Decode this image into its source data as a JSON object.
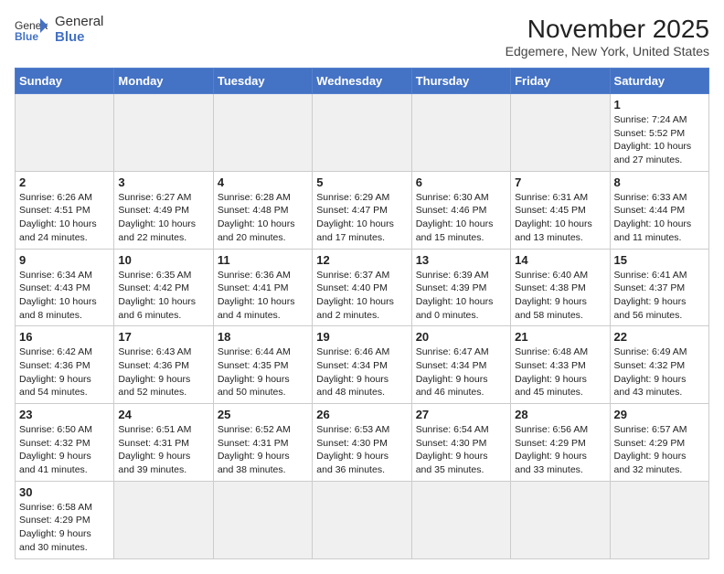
{
  "header": {
    "logo_general": "General",
    "logo_blue": "Blue",
    "title": "November 2025",
    "subtitle": "Edgemere, New York, United States"
  },
  "weekdays": [
    "Sunday",
    "Monday",
    "Tuesday",
    "Wednesday",
    "Thursday",
    "Friday",
    "Saturday"
  ],
  "weeks": [
    [
      {
        "day": "",
        "empty": true
      },
      {
        "day": "",
        "empty": true
      },
      {
        "day": "",
        "empty": true
      },
      {
        "day": "",
        "empty": true
      },
      {
        "day": "",
        "empty": true
      },
      {
        "day": "",
        "empty": true
      },
      {
        "day": "1",
        "info": "Sunrise: 7:24 AM\nSunset: 5:52 PM\nDaylight: 10 hours\nand 27 minutes."
      }
    ],
    [
      {
        "day": "2",
        "info": "Sunrise: 6:26 AM\nSunset: 4:51 PM\nDaylight: 10 hours\nand 24 minutes."
      },
      {
        "day": "3",
        "info": "Sunrise: 6:27 AM\nSunset: 4:49 PM\nDaylight: 10 hours\nand 22 minutes."
      },
      {
        "day": "4",
        "info": "Sunrise: 6:28 AM\nSunset: 4:48 PM\nDaylight: 10 hours\nand 20 minutes."
      },
      {
        "day": "5",
        "info": "Sunrise: 6:29 AM\nSunset: 4:47 PM\nDaylight: 10 hours\nand 17 minutes."
      },
      {
        "day": "6",
        "info": "Sunrise: 6:30 AM\nSunset: 4:46 PM\nDaylight: 10 hours\nand 15 minutes."
      },
      {
        "day": "7",
        "info": "Sunrise: 6:31 AM\nSunset: 4:45 PM\nDaylight: 10 hours\nand 13 minutes."
      },
      {
        "day": "8",
        "info": "Sunrise: 6:33 AM\nSunset: 4:44 PM\nDaylight: 10 hours\nand 11 minutes."
      }
    ],
    [
      {
        "day": "9",
        "info": "Sunrise: 6:34 AM\nSunset: 4:43 PM\nDaylight: 10 hours\nand 8 minutes."
      },
      {
        "day": "10",
        "info": "Sunrise: 6:35 AM\nSunset: 4:42 PM\nDaylight: 10 hours\nand 6 minutes."
      },
      {
        "day": "11",
        "info": "Sunrise: 6:36 AM\nSunset: 4:41 PM\nDaylight: 10 hours\nand 4 minutes."
      },
      {
        "day": "12",
        "info": "Sunrise: 6:37 AM\nSunset: 4:40 PM\nDaylight: 10 hours\nand 2 minutes."
      },
      {
        "day": "13",
        "info": "Sunrise: 6:39 AM\nSunset: 4:39 PM\nDaylight: 10 hours\nand 0 minutes."
      },
      {
        "day": "14",
        "info": "Sunrise: 6:40 AM\nSunset: 4:38 PM\nDaylight: 9 hours\nand 58 minutes."
      },
      {
        "day": "15",
        "info": "Sunrise: 6:41 AM\nSunset: 4:37 PM\nDaylight: 9 hours\nand 56 minutes."
      }
    ],
    [
      {
        "day": "16",
        "info": "Sunrise: 6:42 AM\nSunset: 4:36 PM\nDaylight: 9 hours\nand 54 minutes."
      },
      {
        "day": "17",
        "info": "Sunrise: 6:43 AM\nSunset: 4:36 PM\nDaylight: 9 hours\nand 52 minutes."
      },
      {
        "day": "18",
        "info": "Sunrise: 6:44 AM\nSunset: 4:35 PM\nDaylight: 9 hours\nand 50 minutes."
      },
      {
        "day": "19",
        "info": "Sunrise: 6:46 AM\nSunset: 4:34 PM\nDaylight: 9 hours\nand 48 minutes."
      },
      {
        "day": "20",
        "info": "Sunrise: 6:47 AM\nSunset: 4:34 PM\nDaylight: 9 hours\nand 46 minutes."
      },
      {
        "day": "21",
        "info": "Sunrise: 6:48 AM\nSunset: 4:33 PM\nDaylight: 9 hours\nand 45 minutes."
      },
      {
        "day": "22",
        "info": "Sunrise: 6:49 AM\nSunset: 4:32 PM\nDaylight: 9 hours\nand 43 minutes."
      }
    ],
    [
      {
        "day": "23",
        "info": "Sunrise: 6:50 AM\nSunset: 4:32 PM\nDaylight: 9 hours\nand 41 minutes."
      },
      {
        "day": "24",
        "info": "Sunrise: 6:51 AM\nSunset: 4:31 PM\nDaylight: 9 hours\nand 39 minutes."
      },
      {
        "day": "25",
        "info": "Sunrise: 6:52 AM\nSunset: 4:31 PM\nDaylight: 9 hours\nand 38 minutes."
      },
      {
        "day": "26",
        "info": "Sunrise: 6:53 AM\nSunset: 4:30 PM\nDaylight: 9 hours\nand 36 minutes."
      },
      {
        "day": "27",
        "info": "Sunrise: 6:54 AM\nSunset: 4:30 PM\nDaylight: 9 hours\nand 35 minutes."
      },
      {
        "day": "28",
        "info": "Sunrise: 6:56 AM\nSunset: 4:29 PM\nDaylight: 9 hours\nand 33 minutes."
      },
      {
        "day": "29",
        "info": "Sunrise: 6:57 AM\nSunset: 4:29 PM\nDaylight: 9 hours\nand 32 minutes."
      }
    ],
    [
      {
        "day": "30",
        "info": "Sunrise: 6:58 AM\nSunset: 4:29 PM\nDaylight: 9 hours\nand 30 minutes."
      },
      {
        "day": "",
        "empty": true
      },
      {
        "day": "",
        "empty": true
      },
      {
        "day": "",
        "empty": true
      },
      {
        "day": "",
        "empty": true
      },
      {
        "day": "",
        "empty": true
      },
      {
        "day": "",
        "empty": true
      }
    ]
  ]
}
